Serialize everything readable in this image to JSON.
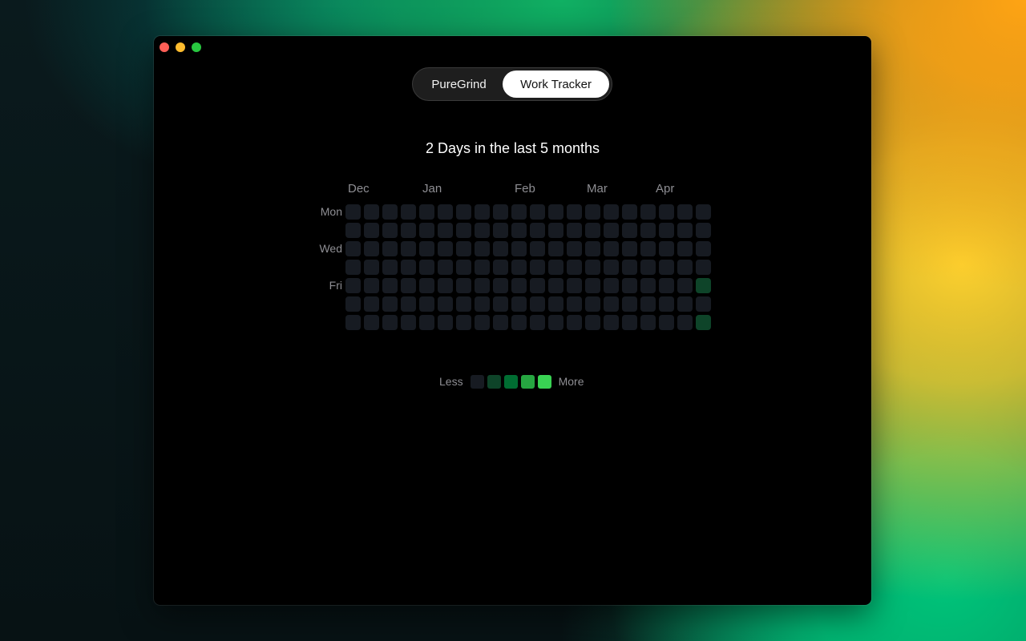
{
  "window": {
    "controls": [
      "close",
      "minimize",
      "zoom"
    ]
  },
  "tabs": {
    "items": [
      {
        "label": "PureGrind",
        "selected": false
      },
      {
        "label": "Work Tracker",
        "selected": true
      }
    ]
  },
  "summary": {
    "heading": "2 Days in the last 5 months"
  },
  "heatmap": {
    "months": [
      "Dec",
      "Jan",
      "Feb",
      "Mar",
      "Apr"
    ],
    "day_labels": [
      "Mon",
      "Wed",
      "Fri"
    ],
    "weeks": 20,
    "days_per_week": 7,
    "active_cells": [
      {
        "week": 19,
        "day": 4,
        "level": 1
      },
      {
        "week": 19,
        "day": 6,
        "level": 1
      }
    ],
    "level_colors": [
      "#171b22",
      "#0e4429",
      "#006d32",
      "#26a641",
      "#39d353"
    ]
  },
  "legend": {
    "less_label": "Less",
    "more_label": "More",
    "swatch_colors": [
      "#171b22",
      "#0e4429",
      "#006d32",
      "#26a641",
      "#39d353"
    ]
  }
}
